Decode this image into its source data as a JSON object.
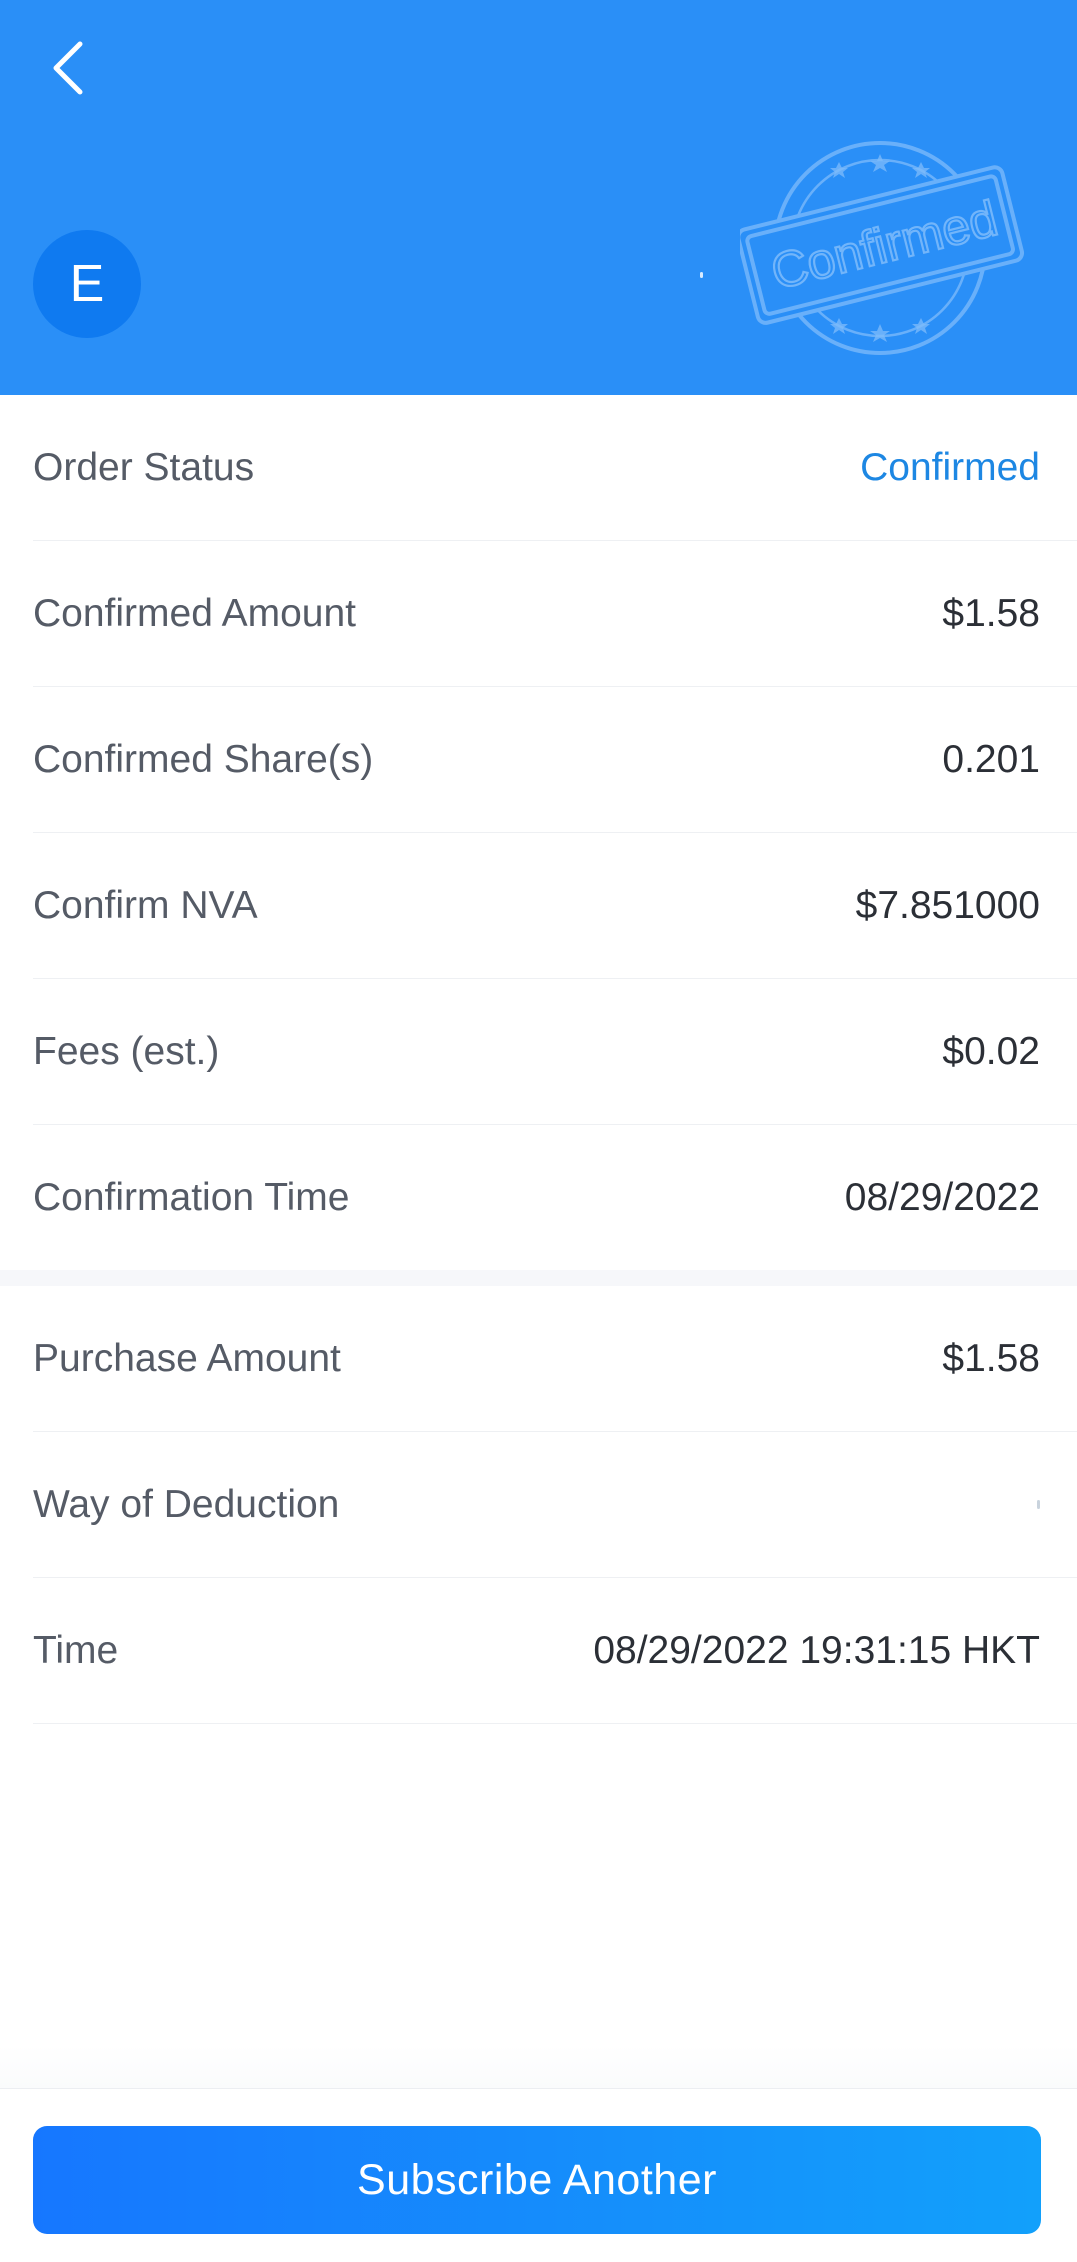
{
  "header": {
    "avatar_letter": "E",
    "stamp_text": "Confirmed",
    "colors": {
      "background": "#2a8ff7",
      "avatar": "#0f7af0"
    }
  },
  "details": [
    {
      "label": "Order Status",
      "value": "Confirmed"
    },
    {
      "label": "Confirmed Amount",
      "value": "$1.58"
    },
    {
      "label": "Confirmed Share(s)",
      "value": "0.201"
    },
    {
      "label": "Confirm NVA",
      "value": "$7.851000"
    },
    {
      "label": "Fees (est.)",
      "value": "$0.02"
    },
    {
      "label": "Confirmation Time",
      "value": "08/29/2022"
    }
  ],
  "purchase": [
    {
      "label": "Purchase Amount",
      "value": "$1.58"
    },
    {
      "label": "Way of Deduction",
      "value": ""
    },
    {
      "label": "Time",
      "value": "08/29/2022 19:31:15 HKT"
    }
  ],
  "footer": {
    "button_label": "Subscribe Another"
  },
  "icons": {
    "back": "chevron-left-icon",
    "stamp": "confirmed-stamp-icon"
  },
  "accent": {
    "status_color": "#1d87e3",
    "button_color": "#1677ff"
  }
}
